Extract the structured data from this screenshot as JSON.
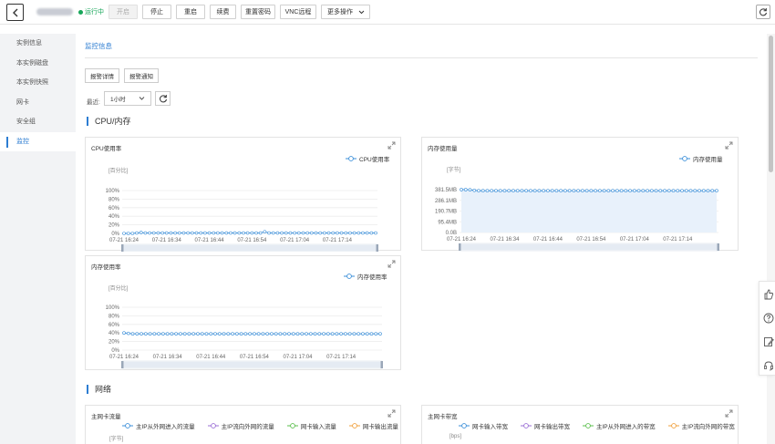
{
  "topbar": {
    "status": "运行中",
    "buttons": [
      {
        "label": "开启",
        "disabled": true
      },
      {
        "label": "停止",
        "disabled": false
      },
      {
        "label": "重启",
        "disabled": false
      },
      {
        "label": "续费",
        "disabled": false
      },
      {
        "label": "重置密码",
        "disabled": false
      },
      {
        "label": "VNC远程",
        "disabled": false
      },
      {
        "label": "更多操作",
        "disabled": false
      }
    ]
  },
  "sidebar": {
    "items": [
      {
        "label": "实例信息",
        "active": false
      },
      {
        "label": "本实例磁盘",
        "active": false
      },
      {
        "label": "本实例快照",
        "active": false
      },
      {
        "label": "网卡",
        "active": false
      },
      {
        "label": "安全组",
        "active": false
      },
      {
        "label": "监控",
        "active": true
      }
    ]
  },
  "main": {
    "tab_title": "监控信息",
    "alarm_detail": "报警详情",
    "alarm_notify": "报警通知",
    "range_label": "最近:",
    "range_value": "1小时",
    "section_cpu": "CPU/内存",
    "section_net": "网络"
  },
  "colors": {
    "accent": "#2d7dd2",
    "line_blue": "#3b8fd9",
    "legend_purple": "#9b6fd6",
    "legend_green": "#5bbf4d",
    "legend_orange": "#f0a03c",
    "status_green": "#17a659"
  },
  "chart_data": [
    {
      "type": "line",
      "title": "CPU使用率",
      "ylabel": "[百分比]",
      "series": [
        {
          "name": "CPU使用率",
          "values": [
            0,
            0,
            0,
            1,
            2,
            1,
            1,
            1,
            1,
            1,
            1,
            1,
            1,
            1,
            1,
            1,
            1,
            1,
            1,
            1,
            1,
            1,
            1,
            1,
            1,
            1,
            1,
            1,
            1,
            1,
            1,
            1,
            1,
            4,
            1,
            1,
            1,
            1,
            1,
            1,
            1,
            1,
            1,
            1,
            1,
            1,
            1,
            1,
            1,
            1,
            1,
            1,
            1,
            1,
            1,
            1,
            1,
            1,
            1,
            1
          ]
        }
      ],
      "yticks": [
        "100%",
        "80%",
        "60%",
        "40%",
        "20%",
        "0%"
      ],
      "ylim": [
        0,
        100
      ],
      "xticks": [
        "07-21 16:24",
        "07-21 16:34",
        "07-21 16:44",
        "07-21 16:54",
        "07-21 17:04",
        "07-21 17:14"
      ]
    },
    {
      "type": "area",
      "title": "内存使用量",
      "ylabel": "[字节]",
      "series": [
        {
          "name": "内存使用量",
          "values": [
            382,
            382,
            380,
            375,
            372,
            372,
            372,
            372,
            372,
            372,
            372,
            372,
            372,
            372,
            372,
            372,
            372,
            372,
            372,
            372,
            372,
            372,
            372,
            372,
            372,
            372,
            372,
            372,
            372,
            372,
            372,
            372,
            372,
            372,
            372,
            372,
            372,
            372,
            372,
            372,
            372,
            372,
            372,
            372,
            372,
            372,
            372,
            372,
            372,
            372,
            372,
            372,
            372,
            372,
            372,
            372,
            372,
            372,
            372,
            372
          ]
        }
      ],
      "yticks": [
        "381.5MB",
        "286.1MB",
        "190.7MB",
        "95.4MB",
        "0.0B"
      ],
      "ylim": [
        0,
        381.5
      ],
      "xticks": [
        "07-21 16:24",
        "07-21 16:34",
        "07-21 16:44",
        "07-21 16:54",
        "07-21 17:04",
        "07-21 17:14"
      ]
    },
    {
      "type": "line",
      "title": "内存使用率",
      "ylabel": "[百分比]",
      "series": [
        {
          "name": "内存使用率",
          "values": [
            40,
            39,
            38,
            38,
            38,
            38,
            38,
            38,
            38,
            38,
            38,
            38,
            38,
            38,
            38,
            38,
            38,
            38,
            38,
            38,
            38,
            38,
            38,
            38,
            38,
            38,
            38,
            38,
            38,
            38,
            38,
            38,
            38,
            38,
            38,
            38,
            38,
            38,
            38,
            38,
            38,
            38,
            38,
            38,
            38,
            38,
            38,
            38,
            38,
            38,
            38,
            38,
            38,
            38,
            38,
            38,
            38,
            38,
            38,
            38
          ]
        }
      ],
      "yticks": [
        "100%",
        "80%",
        "60%",
        "40%",
        "20%",
        "0%"
      ],
      "ylim": [
        0,
        100
      ],
      "xticks": [
        "07-21 16:24",
        "07-21 16:34",
        "07-21 16:44",
        "07-21 16:54",
        "07-21 17:04",
        "07-21 17:14"
      ]
    },
    {
      "type": "line",
      "title": "主网卡流量",
      "ylabel": "[字节]",
      "series": [
        {
          "name": "主IP从外网进入的流量",
          "values": []
        },
        {
          "name": "主IP流向外网的流量",
          "values": []
        },
        {
          "name": "网卡输入流量",
          "values": []
        },
        {
          "name": "网卡输出流量",
          "values": []
        }
      ]
    },
    {
      "type": "line",
      "title": "主网卡带宽",
      "ylabel": "[bps]",
      "series": [
        {
          "name": "网卡输入带宽",
          "values": []
        },
        {
          "name": "网卡输出带宽",
          "values": []
        },
        {
          "name": "主IP从外网进入的带宽",
          "values": []
        },
        {
          "name": "主IP流向外网的带宽",
          "values": []
        }
      ]
    }
  ]
}
